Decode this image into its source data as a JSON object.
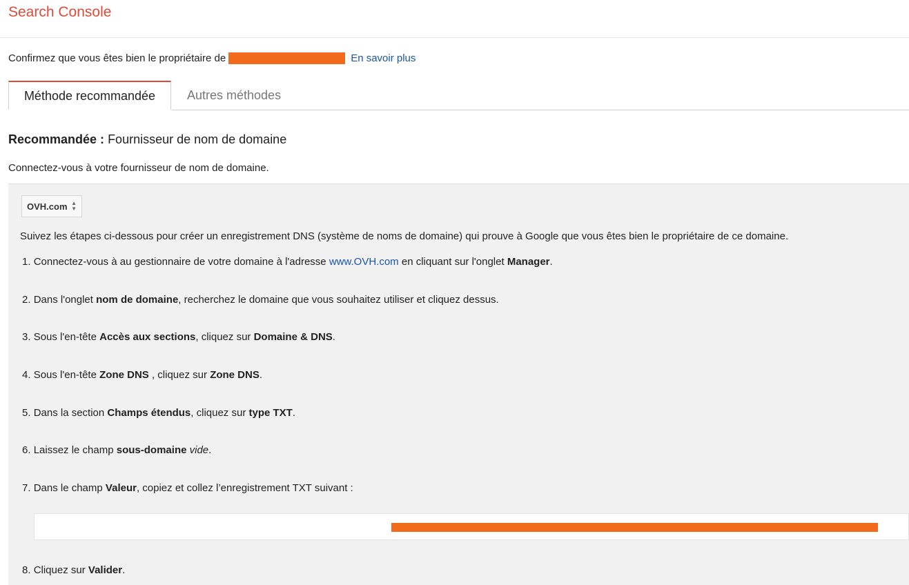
{
  "header": {
    "brand": "Search Console"
  },
  "confirm": {
    "text": "Confirmez que vous êtes bien le propriétaire de",
    "learn_more": "En savoir plus"
  },
  "tabs": [
    {
      "label": "Méthode recommandée"
    },
    {
      "label": "Autres méthodes"
    }
  ],
  "recommended": {
    "label": "Recommandée :",
    "title": "Fournisseur de nom de domaine",
    "connect_text": "Connectez-vous à votre fournisseur de nom de domaine."
  },
  "provider_select": {
    "value": "OVH.com"
  },
  "intro": "Suivez les étapes ci-dessous pour créer un enregistrement DNS (système de noms de domaine) qui prouve à Google que vous êtes bien le propriétaire de ce domaine.",
  "steps": [
    {
      "n": "1.",
      "t1": "Connectez-vous à au gestionnaire de votre domaine à l'adresse",
      "link": "www.OVH.com",
      "t2": "en cliquant sur l'onglet",
      "b1": "Manager",
      "t3": "."
    },
    {
      "n": "2.",
      "t1": "Dans l'onglet",
      "b1": "nom de domaine",
      "t2": ", recherchez le domaine que vous souhaitez utiliser et cliquez dessus."
    },
    {
      "n": "3.",
      "t1": "Sous l'en-tête",
      "b1": "Accès aux sections",
      "t2": ", cliquez sur",
      "b2": "Domaine & DNS",
      "t3": "."
    },
    {
      "n": "4.",
      "t1": "Sous l'en-tête",
      "b1": "Zone DNS",
      "t2": ", cliquez sur",
      "b2": "Zone DNS",
      "t3": "."
    },
    {
      "n": "5.",
      "t1": "Dans la section",
      "b1": "Champs étendus",
      "t2": ", cliquez sur",
      "b2": "type TXT",
      "t3": "."
    },
    {
      "n": "6.",
      "t1": "Laissez le champ",
      "b1": "sous-domaine",
      "i1": "vide",
      "t2": "."
    },
    {
      "n": "7.",
      "t1": "Dans le champ",
      "b1": "Valeur",
      "t2": ", copiez et collez l’enregistrement TXT suivant :"
    },
    {
      "n": "8.",
      "t1": "Cliquez sur",
      "b1": "Valider",
      "t2": "."
    }
  ],
  "colors": {
    "brand": "#dd4b39",
    "link": "#1a55a6",
    "redaction": "#f26b1d",
    "panel": "#f1f1f1"
  }
}
